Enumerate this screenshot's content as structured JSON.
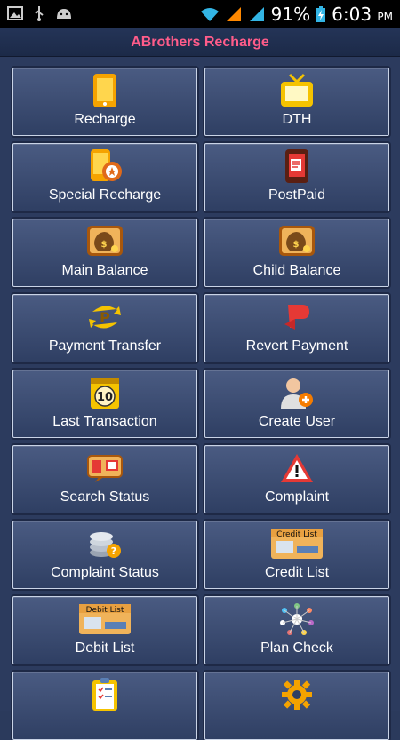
{
  "status_bar": {
    "battery": "91%",
    "time": "6:03",
    "ampm": "PM"
  },
  "title": "ABrothers Recharge",
  "tiles": [
    {
      "label": "Recharge",
      "icon": "phone-icon"
    },
    {
      "label": "DTH",
      "icon": "tv-icon"
    },
    {
      "label": "Special Recharge",
      "icon": "special-recharge-icon"
    },
    {
      "label": "PostPaid",
      "icon": "postpaid-icon"
    },
    {
      "label": "Main Balance",
      "icon": "money-bag-icon"
    },
    {
      "label": "Child Balance",
      "icon": "money-bag-icon"
    },
    {
      "label": "Payment Transfer",
      "icon": "payment-transfer-icon"
    },
    {
      "label": "Revert Payment",
      "icon": "revert-payment-icon"
    },
    {
      "label": "Last Transaction",
      "icon": "last-transaction-icon"
    },
    {
      "label": "Create User",
      "icon": "create-user-icon"
    },
    {
      "label": "Search Status",
      "icon": "search-status-icon"
    },
    {
      "label": "Complaint",
      "icon": "warning-icon"
    },
    {
      "label": "Complaint Status",
      "icon": "coins-question-icon"
    },
    {
      "label": "Credit List",
      "icon": "credit-list-icon"
    },
    {
      "label": "Debit List",
      "icon": "debit-list-icon"
    },
    {
      "label": "Plan Check",
      "icon": "plan-check-icon"
    },
    {
      "label": "",
      "icon": "checklist-icon"
    },
    {
      "label": "",
      "icon": "settings-gear-icon"
    }
  ],
  "icon_text": {
    "last_transaction": "10",
    "credit": "Credit List",
    "debit": "Debit List"
  }
}
